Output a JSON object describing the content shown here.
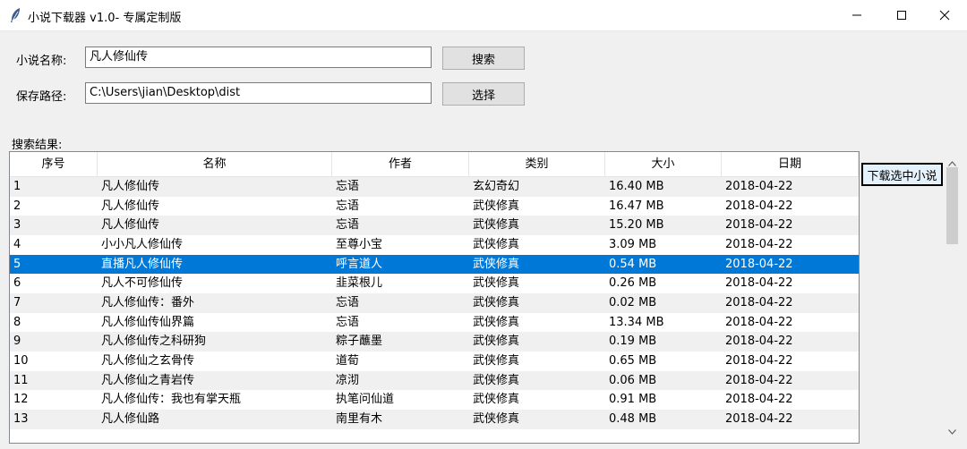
{
  "window": {
    "title": "小说下载器 v1.0- 专属定制版"
  },
  "form": {
    "name_label": "小说名称:",
    "name_value": "凡人修仙传",
    "search_button": "搜索",
    "path_label": "保存路径:",
    "path_value": "C:\\Users\\jian\\Desktop\\dist",
    "choose_button": "选择"
  },
  "results": {
    "label": "搜索结果:",
    "columns": [
      "序号",
      "名称",
      "作者",
      "类别",
      "大小",
      "日期"
    ],
    "selected_index": 4,
    "rows": [
      [
        "1",
        "凡人修仙传",
        "忘语",
        "玄幻奇幻",
        "16.40 MB",
        "2018-04-22"
      ],
      [
        "2",
        "凡人修仙传",
        "忘语",
        "武侠修真",
        "16.47 MB",
        "2018-04-22"
      ],
      [
        "3",
        "凡人修仙传",
        "忘语",
        "武侠修真",
        "15.20 MB",
        "2018-04-22"
      ],
      [
        "4",
        "小小凡人修仙传",
        "至尊小宝",
        "武侠修真",
        "3.09 MB",
        "2018-04-22"
      ],
      [
        "5",
        "直播凡人修仙传",
        "呼言道人",
        "武侠修真",
        "0.54 MB",
        "2018-04-22"
      ],
      [
        "6",
        "凡人不可修仙传",
        "韭菜根儿",
        "武侠修真",
        "0.26 MB",
        "2018-04-22"
      ],
      [
        "7",
        "凡人修仙传：番外",
        "忘语",
        "武侠修真",
        "0.02 MB",
        "2018-04-22"
      ],
      [
        "8",
        "凡人修仙传仙界篇",
        "忘语",
        "武侠修真",
        "13.34 MB",
        "2018-04-22"
      ],
      [
        "9",
        "凡人修仙传之科研狗",
        "粽子蘸墨",
        "武侠修真",
        "0.19 MB",
        "2018-04-22"
      ],
      [
        "10",
        "凡人修仙之玄骨传",
        "道荀",
        "武侠修真",
        "0.65 MB",
        "2018-04-22"
      ],
      [
        "11",
        "凡人修仙之青岩传",
        "凉沏",
        "武侠修真",
        "0.06 MB",
        "2018-04-22"
      ],
      [
        "12",
        "凡人修仙传：我也有掌天瓶",
        "执笔问仙道",
        "武侠修真",
        "0.91 MB",
        "2018-04-22"
      ],
      [
        "13",
        "凡人修仙路",
        "南里有木",
        "武侠修真",
        "0.48 MB",
        "2018-04-22"
      ]
    ]
  },
  "download_button": "下载选中小说",
  "colors": {
    "selection": "#0078d7",
    "alt_row": "#f0f0f0"
  },
  "icons": {
    "app": "feather-icon",
    "minimize": "minimize-icon",
    "maximize": "maximize-icon",
    "close": "close-icon"
  }
}
